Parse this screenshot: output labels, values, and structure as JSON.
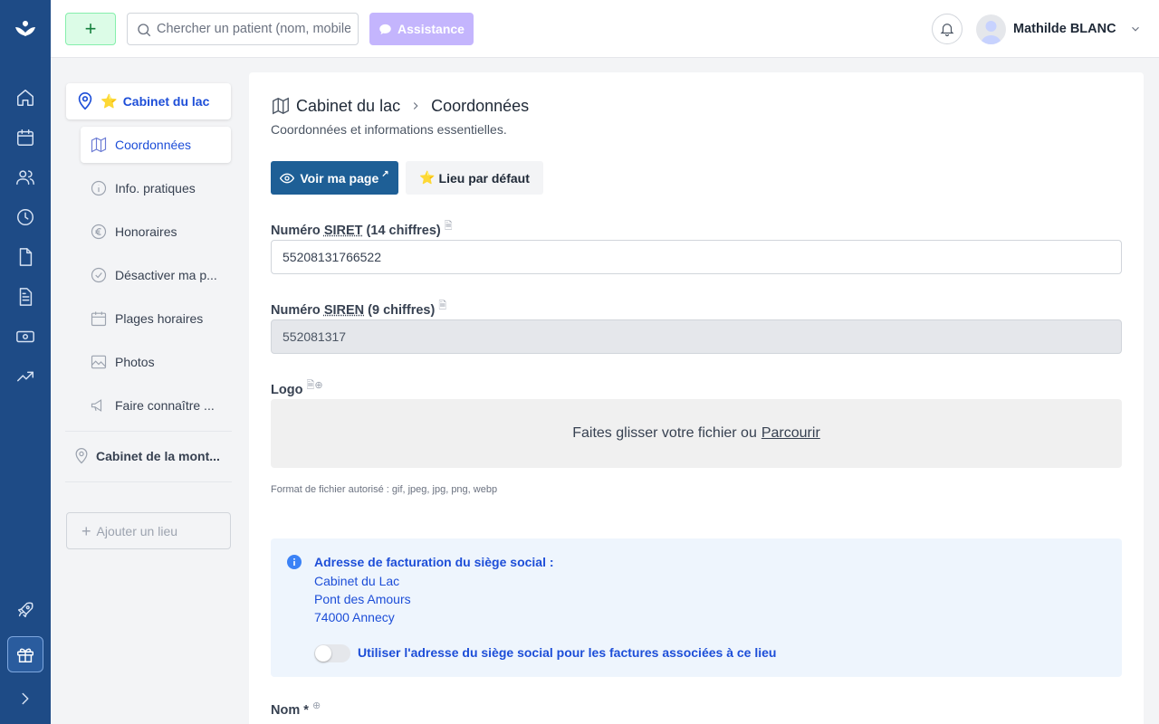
{
  "topbar": {
    "add_label": "+",
    "search_placeholder": "Chercher un patient (nom, mobile...)",
    "assist_label": "Assistance",
    "user_name": "Mathilde BLANC"
  },
  "sidebar": {
    "location_name": "Cabinet du lac",
    "items": [
      {
        "label": "Coordonnées",
        "icon": "map-icon",
        "active": true
      },
      {
        "label": "Info. pratiques",
        "icon": "info-icon"
      },
      {
        "label": "Honoraires",
        "icon": "euro-icon"
      },
      {
        "label": "Désactiver ma p...",
        "icon": "check-circle-icon"
      },
      {
        "label": "Plages horaires",
        "icon": "calendar-icon"
      },
      {
        "label": "Photos",
        "icon": "image-icon"
      },
      {
        "label": "Faire connaître ...",
        "icon": "megaphone-icon"
      }
    ],
    "other_location": "Cabinet de la mont...",
    "add_location": "Ajouter un lieu"
  },
  "main": {
    "breadcrumb_root": "Cabinet du lac",
    "breadcrumb_current": "Coordonnées",
    "subtitle": "Coordonnées et informations essentielles.",
    "view_page_label": "Voir ma page",
    "default_place_label": "Lieu par défaut",
    "siret_label_prefix": "Numéro ",
    "siret_abbr": "SIRET",
    "siret_label_suffix": " (14 chiffres)",
    "siret_value": "55208131766522",
    "siren_label_prefix": "Numéro ",
    "siren_abbr": "SIREN",
    "siren_label_suffix": " (9 chiffres)",
    "siren_value": "552081317",
    "logo_label": "Logo",
    "dropzone_text": "Faites glisser votre fichier ou",
    "dropzone_link": "Parcourir",
    "format_hint": "Format de fichier autorisé : gif, jpeg, jpg, png, webp",
    "billing_title": "Adresse de facturation du siège social :",
    "billing_line1": "Cabinet du Lac",
    "billing_line2": "Pont des Amours",
    "billing_line3": "74000 Annecy",
    "toggle_label": "Utiliser l'adresse du siège social pour les factures associées à ce lieu",
    "toggle_on": false,
    "name_label": "Nom *"
  },
  "colors": {
    "rail": "#1e4b86",
    "primary_button": "#1e5f96",
    "link_blue": "#1d4ed8",
    "assist": "#c4b5fd",
    "add_green": "#dcfce7"
  }
}
